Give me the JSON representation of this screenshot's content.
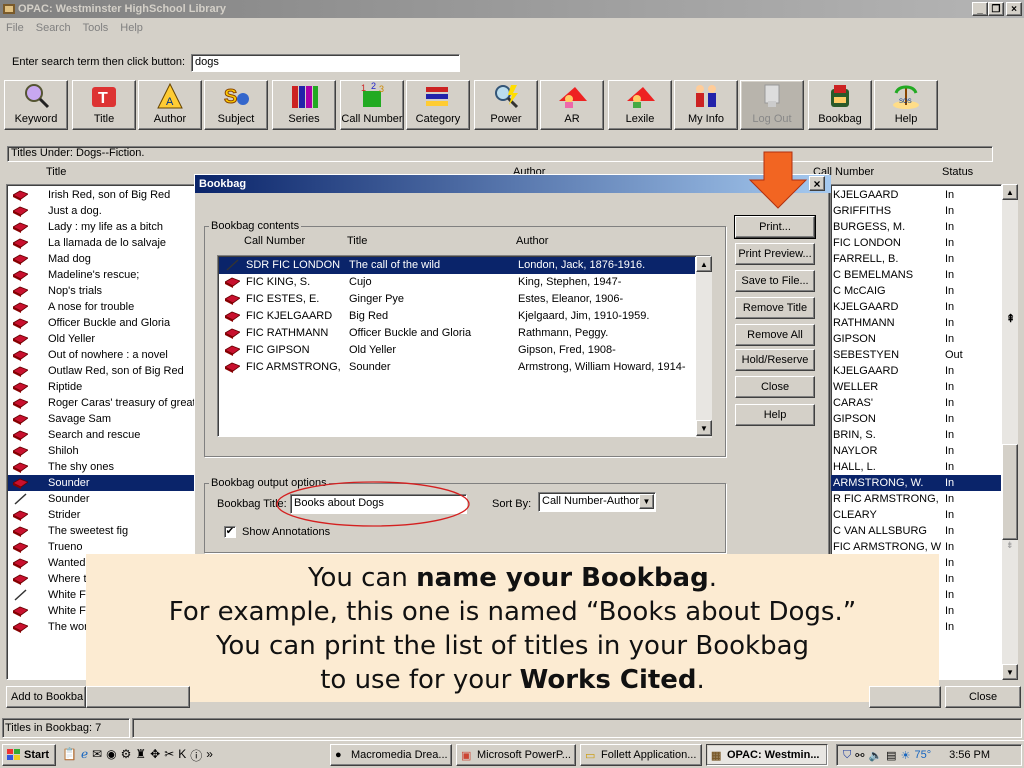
{
  "window": {
    "title": "OPAC: Westminster HighSchool Library"
  },
  "menu": [
    "File",
    "Search",
    "Tools",
    "Help"
  ],
  "search": {
    "label": "Enter search term then click button:",
    "value": "dogs"
  },
  "toolbar": [
    {
      "label": "Keyword",
      "icon": "magnifier-icon"
    },
    {
      "label": "Title",
      "icon": "title-t-icon"
    },
    {
      "label": "Author",
      "icon": "author-icon"
    },
    {
      "label": "Subject",
      "icon": "subject-icon"
    },
    {
      "label": "Series",
      "icon": "books-icon"
    },
    {
      "label": "Call Number",
      "icon": "call-number-icon"
    },
    {
      "label": "Category",
      "icon": "category-icon"
    },
    {
      "label": "Power",
      "icon": "power-icon"
    },
    {
      "label": "AR",
      "icon": "ar-reader-icon"
    },
    {
      "label": "Lexile",
      "icon": "lexile-reader-icon"
    },
    {
      "label": "My Info",
      "icon": "people-icon"
    },
    {
      "label": "Log Out",
      "icon": "logout-icon"
    },
    {
      "label": "Bookbag",
      "icon": "bookbag-icon"
    },
    {
      "label": "Help",
      "icon": "help-island-icon"
    }
  ],
  "titles_under": "Titles Under: Dogs--Fiction.",
  "columns": {
    "title": "Title",
    "author": "Author",
    "call_number": "Call Number",
    "status": "Status"
  },
  "titles": [
    "Irish Red, son of Big Red",
    "Just a dog.",
    "Lady : my life as a bitch",
    "La llamada de lo salvaje",
    "Mad dog",
    "Madeline's rescue;",
    "Nop's trials",
    "A nose for trouble",
    "Officer Buckle and Gloria",
    "Old Yeller",
    "Out of nowhere : a novel",
    "Outlaw Red, son of Big Red",
    "Riptide",
    "Roger Caras' treasury of great dog stories",
    "Savage Sam",
    "Search and rescue",
    "Shiloh",
    "The shy ones",
    "Sounder",
    "Sounder",
    "Strider",
    "The sweetest fig",
    "Trueno",
    "Wanted",
    "Where t",
    "White F",
    "White F",
    "The wor"
  ],
  "call_numbers": [
    {
      "call": "KJELGAARD",
      "status": "In"
    },
    {
      "call": "GRIFFITHS",
      "status": "In"
    },
    {
      "call": "BURGESS, M.",
      "status": "In"
    },
    {
      "call": "FIC LONDON",
      "status": "In"
    },
    {
      "call": "FARRELL, B.",
      "status": "In"
    },
    {
      "call": "C  BEMELMANS",
      "status": "In"
    },
    {
      "call": "C McCAIG",
      "status": "In"
    },
    {
      "call": "KJELGAARD",
      "status": "In"
    },
    {
      "call": "RATHMANN",
      "status": "In"
    },
    {
      "call": "GIPSON",
      "status": "In"
    },
    {
      "call": "SEBESTYEN",
      "status": "Out"
    },
    {
      "call": "KJELGAARD",
      "status": "In"
    },
    {
      "call": "WELLER",
      "status": "In"
    },
    {
      "call": "CARAS'",
      "status": "In"
    },
    {
      "call": "GIPSON",
      "status": "In"
    },
    {
      "call": "BRIN, S.",
      "status": "In"
    },
    {
      "call": "NAYLOR",
      "status": "In"
    },
    {
      "call": "HALL, L.",
      "status": "In"
    },
    {
      "call": "ARMSTRONG, W.",
      "status": "In"
    },
    {
      "call": "R FIC ARMSTRONG,",
      "status": "In"
    },
    {
      "call": "CLEARY",
      "status": "In"
    },
    {
      "call": "C VAN ALLSBURG",
      "status": "In"
    },
    {
      "call": "FIC ARMSTRONG, W",
      "status": "In"
    },
    {
      "call": "",
      "status": "In"
    },
    {
      "call": "",
      "status": "In"
    },
    {
      "call": "",
      "status": "In"
    },
    {
      "call": "",
      "status": "In"
    },
    {
      "call": "",
      "status": "In"
    }
  ],
  "selected_index": 18,
  "dialog": {
    "title": "Bookbag",
    "contents_legend": "Bookbag contents",
    "headers": {
      "call": "Call Number",
      "title": "Title",
      "author": "Author"
    },
    "items": [
      {
        "call": "SDR FIC LONDON",
        "title": "The call of the wild",
        "author": "London, Jack, 1876-1916."
      },
      {
        "call": "FIC KING, S.",
        "title": "Cujo",
        "author": "King, Stephen, 1947-"
      },
      {
        "call": "FIC ESTES, E.",
        "title": "Ginger Pye",
        "author": "Estes, Eleanor, 1906-"
      },
      {
        "call": "FIC KJELGAARD",
        "title": "Big Red",
        "author": "Kjelgaard, Jim, 1910-1959."
      },
      {
        "call": "FIC RATHMANN",
        "title": "Officer Buckle and Gloria",
        "author": "Rathmann, Peggy."
      },
      {
        "call": "FIC GIPSON",
        "title": "Old Yeller",
        "author": "Gipson, Fred, 1908-"
      },
      {
        "call": "FIC ARMSTRONG,",
        "title": "Sounder",
        "author": "Armstrong, William Howard, 1914-"
      }
    ],
    "buttons": [
      "Print...",
      "Print Preview...",
      "Save to File...",
      "Remove Title",
      "Remove All",
      "Hold/Reserve",
      "Close",
      "Help"
    ],
    "output_legend": "Bookbag output options",
    "bookbag_title_label": "Bookbag Title:",
    "bookbag_title_value": "Books about Dogs",
    "sort_by_label": "Sort By:",
    "sort_by_value": "Call Number-Author",
    "show_annotations": "Show Annotations"
  },
  "caption": {
    "l1a": "You can ",
    "l1b": "name your Bookbag",
    "l1c": ".",
    "l2": "For example, this one is named “Books about Dogs.”",
    "l3": "You can print the list of titles in your Bookbag",
    "l4a": "to use for your ",
    "l4b": "Works Cited",
    "l4c": "."
  },
  "bottom": {
    "add_to_bookbag": "Add to Bookba",
    "close": "Close",
    "status": "Titles in Bookbag:  7"
  },
  "taskbar": {
    "start": "Start",
    "tasks": [
      "Macromedia Drea...",
      "Microsoft PowerP...",
      "Follett Application...",
      "OPAC: Westmin..."
    ],
    "clock": "3:56 PM",
    "temp": "75°"
  },
  "colors": {
    "selection": "#0a246a",
    "book_red": "#c8102e",
    "arrow": "#f26522",
    "caption_bg": "#fcebd2",
    "ellipse": "#d42020"
  }
}
